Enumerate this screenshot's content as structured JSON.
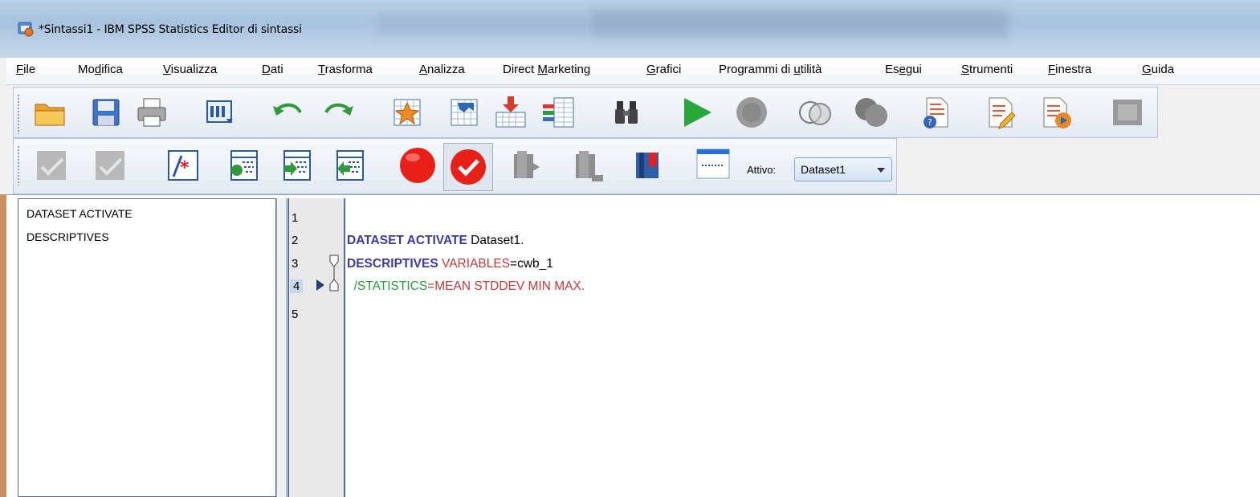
{
  "window": {
    "title": "*Sintassi1 - IBM SPSS Statistics Editor di sintassi",
    "icon": "spss-app-icon"
  },
  "menu": [
    {
      "pre": "",
      "ul": "F",
      "post": "ile"
    },
    {
      "pre": "Mo",
      "ul": "d",
      "post": "ifica"
    },
    {
      "pre": "",
      "ul": "V",
      "post": "isualizza"
    },
    {
      "pre": "",
      "ul": "D",
      "post": "ati"
    },
    {
      "pre": "",
      "ul": "T",
      "post": "rasforma"
    },
    {
      "pre": "",
      "ul": "A",
      "post": "nalizza"
    },
    {
      "pre": "Direct ",
      "ul": "M",
      "post": "arketing"
    },
    {
      "pre": "",
      "ul": "G",
      "post": "rafici"
    },
    {
      "pre": "Programmi di ",
      "ul": "u",
      "post": "tilità"
    },
    {
      "pre": "Es",
      "ul": "e",
      "post": "gui"
    },
    {
      "pre": "",
      "ul": "S",
      "post": "trumenti"
    },
    {
      "pre": "",
      "ul": "F",
      "post": "inestra"
    },
    {
      "pre": "",
      "ul": "G",
      "post": "uida"
    }
  ],
  "toolbar1_icons": [
    "open-folder-icon",
    "save-icon",
    "print-icon",
    "dialog-recall-icon",
    "undo-icon",
    "redo-icon",
    "star-template-icon",
    "variables-icon",
    "insert-cases-icon",
    "insert-variable-icon",
    "find-icon",
    "run-icon",
    "stop-icon",
    "split-file-icon",
    "weight-cases-icon",
    "help-syntax-icon",
    "edit-syntax-icon",
    "run-syntax-icon",
    "grey-panel-icon"
  ],
  "toolbar2_icons": [
    "check-disabled-icon",
    "check-disabled-icon-2",
    "comment-icon",
    "step-into-icon",
    "step-forward-icon",
    "step-back-icon",
    "breakpoint-icon",
    "validate-icon",
    "bookmark-prev-icon",
    "bookmark-next-icon",
    "bookmark-icon",
    "line-numbers-icon"
  ],
  "active_dataset": {
    "label": "Attivo:",
    "value": "Dataset1"
  },
  "navigator": {
    "items": [
      "DATASET ACTIVATE",
      "DESCRIPTIVES"
    ]
  },
  "editor": {
    "line_numbers": [
      "1",
      "2",
      "3",
      "4",
      "5"
    ],
    "current_line": "4",
    "lines": [
      {
        "kw": "",
        "rest": "",
        "sub": "",
        "tail": ""
      },
      {
        "kw": "DATASET ACTIVATE",
        "rest": " Dataset1.",
        "sub": "",
        "tail": ""
      },
      {
        "kw": "DESCRIPTIVES",
        "rest": " ",
        "sub": "VARIABLES",
        "tail": "=cwb_1"
      },
      {
        "stat": "  /STATISTICS",
        "eq": "=",
        "vals": "MEAN STDDEV MIN MAX."
      },
      {
        "kw": "",
        "rest": "",
        "sub": "",
        "tail": ""
      }
    ]
  },
  "colors": {
    "keyword": "#3a3aa0",
    "subcommand": "#c23a3a",
    "statistics": "#28983a"
  }
}
